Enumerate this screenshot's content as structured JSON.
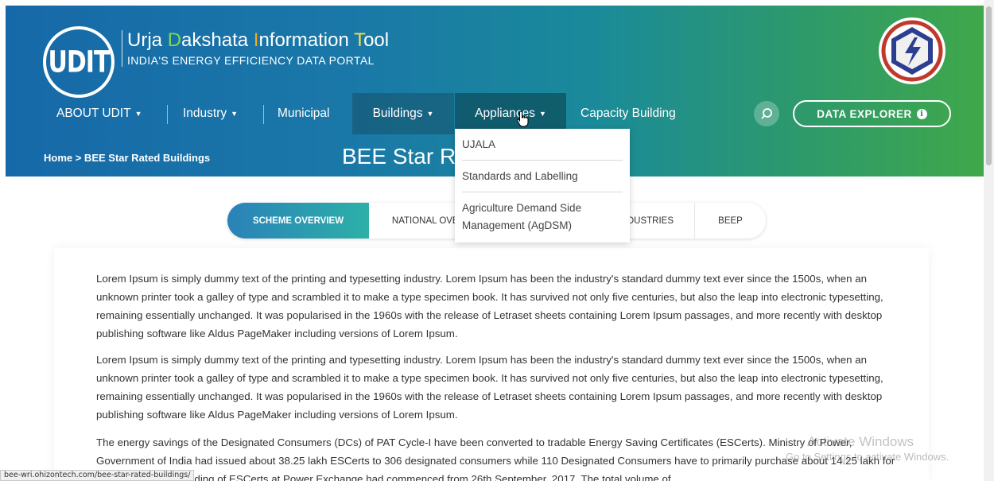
{
  "header": {
    "logo_text": "UDIT",
    "title_parts": [
      "U",
      "rja ",
      "D",
      "akshata ",
      "I",
      "nformation ",
      "T",
      "ool"
    ],
    "subtitle": "INDIA'S ENERGY EFFICIENCY DATA PORTAL"
  },
  "nav": {
    "items": [
      {
        "label": "ABOUT UDIT",
        "has_dropdown": true
      },
      {
        "label": "Industry",
        "has_dropdown": true
      },
      {
        "label": "Municipal",
        "has_dropdown": false
      },
      {
        "label": "Buildings",
        "has_dropdown": true
      },
      {
        "label": "Appliances",
        "has_dropdown": true
      },
      {
        "label": "Capacity Building",
        "has_dropdown": false
      }
    ],
    "chevron": "⌄",
    "explorer_label": "DATA EXPLORER",
    "info_glyph": "i"
  },
  "appliances_menu": [
    "UJALA",
    "Standards and Labelling",
    "Agriculture Demand Side Management (AgDSM)"
  ],
  "subbar": {
    "breadcrumb": "Home > BEE Star Rated Buildings",
    "page_title": "BEE Star Rated Buildings"
  },
  "tabs": [
    {
      "label": "SCHEME OVERVIEW",
      "active": true
    },
    {
      "label": "NATIONAL OVERVIEW",
      "active": false
    },
    {
      "label": "INDUSTRIES",
      "active": false
    },
    {
      "label": "BEEP",
      "active": false
    }
  ],
  "content": {
    "para1": "Lorem Ipsum is simply dummy text of the printing and typesetting industry. Lorem Ipsum has been the industry's standard dummy text ever since the 1500s, when an unknown printer took a galley of type and scrambled it to make a type specimen book. It has survived not only five centuries, but also the leap into electronic typesetting, remaining essentially unchanged. It was popularised in the 1960s with the release of Letraset sheets containing Lorem Ipsum passages, and more recently with desktop publishing software like Aldus PageMaker including versions of Lorem Ipsum.",
    "para2": "Lorem Ipsum is simply dummy text of the printing and typesetting industry. Lorem Ipsum has been the industry's standard dummy text ever since the 1500s, when an unknown printer took a galley of type and scrambled it to make a type specimen book. It has survived not only five centuries, but also the leap into electronic typesetting, remaining essentially unchanged. It was popularised in the 1960s with the release of Letraset sheets containing Lorem Ipsum passages, and more recently with desktop publishing software like Aldus PageMaker including versions of Lorem Ipsum.",
    "para3": "The energy savings of the Designated Consumers (DCs) of PAT Cycle-I have been converted to tradable Energy Saving Certificates (ESCerts). Ministry of Power, Government of India had issued about 38.25 lakh ESCerts to 306 designated consumers while 110 Designated Consumers have to primarily purchase about 14.25 lakh for their compliance. Trading of ESCerts at Power Exchange had commenced from 26th September, 2017. The total volume of"
  },
  "watermark": {
    "line1": "Activate Windows",
    "line2": "Go to Settings to activate Windows."
  },
  "status_url": "bee-wri.ohizontech.com/bee-star-rated-buildings/",
  "colors": {
    "header_start": "#1669a8",
    "header_end": "#3fa84a",
    "tab_active_start": "#2a82b8",
    "tab_active_end": "#2db0a8",
    "accent_green": "#7ed957",
    "accent_orange": "#f6a623"
  },
  "icons": {
    "search": "search-icon",
    "info": "info-icon",
    "chevron": "chevron-down-icon",
    "cursor": "hand-cursor-icon"
  }
}
